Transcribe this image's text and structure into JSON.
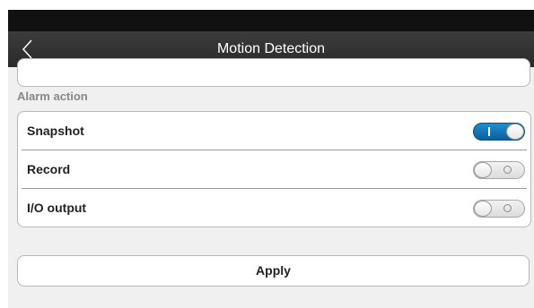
{
  "header": {
    "title": "Motion Detection",
    "back_icon": "chevron-left-icon"
  },
  "alarm_action": {
    "section_label": "Alarm action",
    "items": [
      {
        "label": "Snapshot",
        "enabled": true
      },
      {
        "label": "Record",
        "enabled": false
      },
      {
        "label": "I/O output",
        "enabled": false
      }
    ]
  },
  "apply_label": "Apply",
  "colors": {
    "toggle_on": "#0b6fb2",
    "navbar": "#2f2f2f",
    "statusbar": "#111111",
    "background": "#f0f0f0"
  }
}
